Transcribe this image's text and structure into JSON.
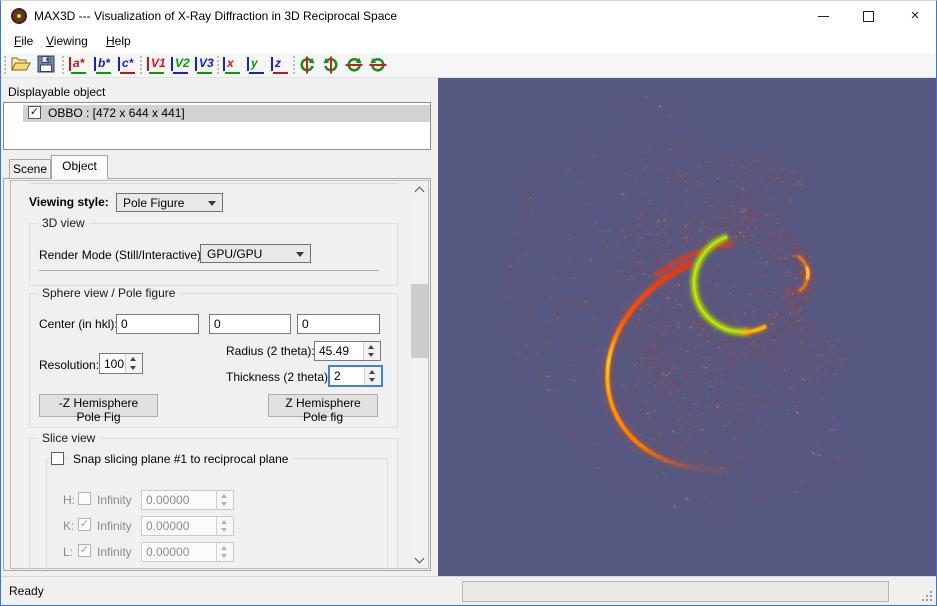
{
  "window": {
    "title": "MAX3D --- Visualization of X-Ray Diffraction in 3D Reciprocal Space"
  },
  "icons": {
    "close_glyph": "×"
  },
  "menu": {
    "items": [
      {
        "head": "F",
        "tail": "ile"
      },
      {
        "head": "V",
        "tail": "iewing"
      },
      {
        "head": "H",
        "tail": "elp"
      }
    ]
  },
  "toolbar": {
    "letters": [
      {
        "label": "a*",
        "color": "#cc1111",
        "bar": "#cc1111",
        "underline": "#00a000"
      },
      {
        "label": "b*",
        "color": "#1122cc",
        "bar": "#1122cc",
        "underline": "#00a000"
      },
      {
        "label": "c*",
        "color": "#1122cc",
        "bar": "#1122cc",
        "underline": "#cc1111"
      },
      {
        "label": "V1",
        "color": "#dd1111",
        "bar": "#cc1111",
        "underline": "#00a000"
      },
      {
        "label": "V2",
        "color": "#00a000",
        "bar": "#1122cc",
        "underline": "#1122cc"
      },
      {
        "label": "V3",
        "color": "#1122cc",
        "bar": "#1122cc",
        "underline": "#00a000"
      },
      {
        "label": "x",
        "color": "#dd1111",
        "bar": "#1122cc",
        "underline": "#00a000"
      },
      {
        "label": "y",
        "color": "#00a000",
        "bar": "#1122cc",
        "underline": "#1122cc"
      },
      {
        "label": "z",
        "color": "#1122cc",
        "bar": "#1122cc",
        "underline": "#cc1111"
      }
    ]
  },
  "displayable": {
    "header": "Displayable object",
    "item": {
      "label": "OBBO : [472 x 644 x 441]",
      "check": "✓"
    }
  },
  "tabs": [
    {
      "label": "Scene"
    },
    {
      "label": "Object"
    }
  ],
  "panel": {
    "viewing_style_label": "Viewing style:",
    "viewing_style_value": "Pole Figure",
    "view3d": {
      "title": "3D view",
      "render_mode_label": "Render Mode (Still/Interactive):",
      "render_mode_value": "GPU/GPU"
    },
    "sphere": {
      "title": "Sphere view / Pole figure",
      "center_label": "Center (in hkl):",
      "center_values": [
        "0",
        "0",
        "0"
      ],
      "resolution_label": "Resolution:",
      "resolution_value": "100",
      "radius_label": "Radius (2 theta):",
      "radius_value": "45.49",
      "thickness_label": "Thickness (2 theta):",
      "thickness_value": "2",
      "btn_neg_z": "-Z Hemisphere Pole Fig",
      "btn_pos_z": "Z Hemisphere Pole fig"
    },
    "slice": {
      "title": "Slice view",
      "snap_label": "Snap slicing plane #1 to reciprocal plane",
      "snap_check": "",
      "rows": [
        {
          "label": "H:",
          "check": "",
          "infinity_label": "Infinity",
          "value": "0.00000"
        },
        {
          "label": "K:",
          "check": "✓",
          "infinity_label": "Infinity",
          "value": "0.00000"
        },
        {
          "label": "L:",
          "check": "✓",
          "infinity_label": "Infinity",
          "value": "0.00000"
        }
      ]
    }
  },
  "status": {
    "ready": "Ready"
  },
  "viewport": {
    "background": "#575881",
    "colors": {
      "points": "#cd2a12",
      "points_orange": "#f05c0c",
      "points_bright": "#ffb018",
      "arc_green_core": "#c6e61e",
      "arc_green": "#7fb800",
      "arc_red": "#ff2200",
      "arc_yellow": "#ffc818",
      "arc_orange": "#ff7a00"
    }
  }
}
